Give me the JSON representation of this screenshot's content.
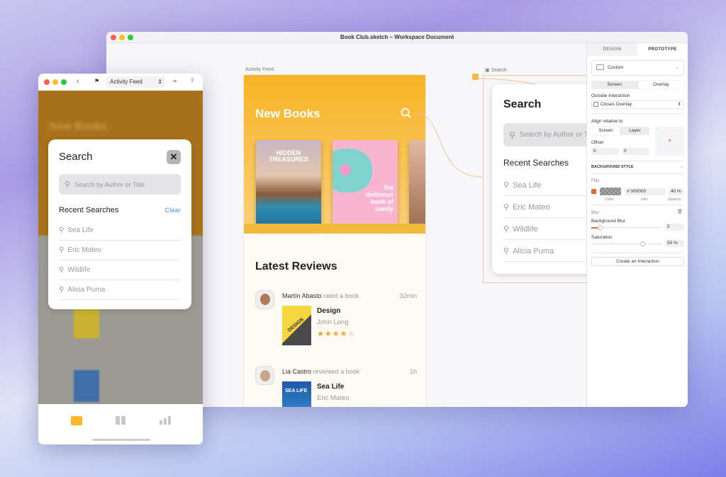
{
  "window": {
    "title": "Book Club.sketch – Workspace Document"
  },
  "canvas": {
    "feed_label": "Activity Feed",
    "search_label": "Search",
    "feed": {
      "header": "New Books",
      "books": [
        {
          "title": "HIDDEN TREASURES"
        },
        {
          "title": "the delicious book of candy"
        }
      ],
      "reviews_heading": "Latest Reviews",
      "reviews": [
        {
          "user": "Martín Abasto",
          "action": "rated a book",
          "time": "32min",
          "book": "Design",
          "author": "John Long",
          "rating": 4,
          "cover_text": "DESIGN"
        },
        {
          "user": "Lia Castro",
          "action": "reviewed a book",
          "time": "1h",
          "book": "Sea Life",
          "author": "Eric Mateo",
          "cover_text": "SEA LIFE"
        }
      ]
    },
    "search": {
      "title": "Search",
      "placeholder": "Search by Author or Title",
      "recent_heading": "Recent Searches",
      "recent": [
        "Sea Life",
        "Eric Mateo",
        "Wildlife",
        "Alicia Puma"
      ]
    }
  },
  "inspector": {
    "tabs": [
      "DESIGN",
      "PROTOTYPE"
    ],
    "active_tab": "PROTOTYPE",
    "device": "Custom",
    "mode": [
      "Screen",
      "Overlay"
    ],
    "mode_selected": "Overlay",
    "outside_label": "Outside Interaction",
    "outside_value": "Closes Overlay",
    "align_label": "Align relative to",
    "align": [
      "Screen",
      "Layer"
    ],
    "align_selected": "Screen",
    "offset_label": "Offset",
    "offset_x": "0",
    "offset_y": "0",
    "bg_style": "BACKGROUND STYLE",
    "fills_label": "Fills",
    "fill_enabled": true,
    "hex": "# 000000",
    "opacity": "40",
    "opacity_unit": "%",
    "color_caption": "Color",
    "hex_caption": "Hex",
    "opacity_caption": "Opacity",
    "blur_label": "Blur",
    "bg_blur_label": "Background Blur",
    "bg_blur": "5",
    "saturation_label": "Saturation",
    "saturation": "50",
    "saturation_unit": "%",
    "create_button": "Create an Interaction",
    "accent": "#e8682a"
  },
  "preview": {
    "page_selector": "Activity Feed",
    "header": "New Books",
    "modal": {
      "title": "Search",
      "placeholder": "Search by Author or Title",
      "recent_heading": "Recent Searches",
      "clear": "Clear",
      "recent": [
        "Sea Life",
        "Eric Mateo",
        "Wildlife",
        "Alicia Puma"
      ]
    },
    "tabbar": [
      "books-icon",
      "library-icon",
      "stats-icon"
    ],
    "active_tab": 0,
    "accent": "#fbb72b",
    "link": "#4a90d9"
  }
}
